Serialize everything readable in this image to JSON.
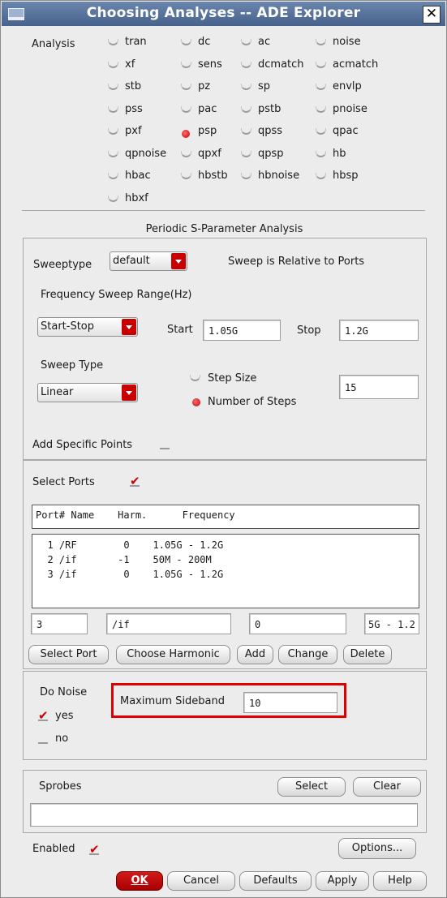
{
  "window": {
    "title": "Choosing Analyses -- ADE Explorer",
    "close_glyph": "✕"
  },
  "analysis": {
    "label": "Analysis",
    "options": [
      "tran",
      "dc",
      "ac",
      "noise",
      "xf",
      "sens",
      "dcmatch",
      "acmatch",
      "stb",
      "pz",
      "sp",
      "envlp",
      "pss",
      "pac",
      "pstb",
      "pnoise",
      "pxf",
      "psp",
      "qpss",
      "qpac",
      "qpnoise",
      "qpxf",
      "qpsp",
      "hb",
      "hbac",
      "hbstb",
      "hbnoise",
      "hbsp",
      "hbxf"
    ],
    "selected": "psp"
  },
  "psp": {
    "section_title": "Periodic S-Parameter Analysis",
    "sweeptype_label": "Sweeptype",
    "sweeptype_value": "default",
    "sweep_relative_text": "Sweep is Relative to Ports",
    "freq_range_label": "Frequency Sweep Range(Hz)",
    "range_mode": "Start-Stop",
    "start_label": "Start",
    "start_value": "1.05G",
    "stop_label": "Stop",
    "stop_value": "1.2G",
    "sweep_type_label": "Sweep Type",
    "sweep_type_value": "Linear",
    "step_size_label": "Step Size",
    "num_steps_label": "Number of Steps",
    "num_steps_selected": true,
    "num_steps_value": "15",
    "add_points_label": "Add Specific Points",
    "add_points_checked": false
  },
  "ports": {
    "select_ports_label": "Select Ports",
    "select_ports_checked": true,
    "header": "Port# Name    Harm.      Frequency",
    "rows": [
      "  1 /RF        0    1.05G - 1.2G",
      "  2 /if       -1    50M - 200M",
      "  3 /if        0    1.05G - 1.2G"
    ],
    "edit_port": "3",
    "edit_name": "/if",
    "edit_harm": "0",
    "edit_freq": "5G - 1.2",
    "buttons": {
      "select_port": "Select Port",
      "choose_harmonic": "Choose Harmonic",
      "add": "Add",
      "change": "Change",
      "delete": "Delete"
    }
  },
  "noise": {
    "do_noise_label": "Do Noise",
    "yes_label": "yes",
    "no_label": "no",
    "yes_checked": true,
    "max_sideband_label": "Maximum Sideband",
    "max_sideband_value": "10",
    "highlight_color": "#e00000"
  },
  "sprobes": {
    "label": "Sprobes",
    "select_button": "Select",
    "clear_button": "Clear",
    "value": ""
  },
  "footer": {
    "enabled_label": "Enabled",
    "enabled_checked": true,
    "options_button": "Options...",
    "ok_button": "OK",
    "cancel_button": "Cancel",
    "defaults_button": "Defaults",
    "apply_button": "Apply",
    "help_button": "Help"
  },
  "colors": {
    "titlebar": "#5a7399",
    "accent_red": "#c80000",
    "panel_bg": "#ececec"
  }
}
